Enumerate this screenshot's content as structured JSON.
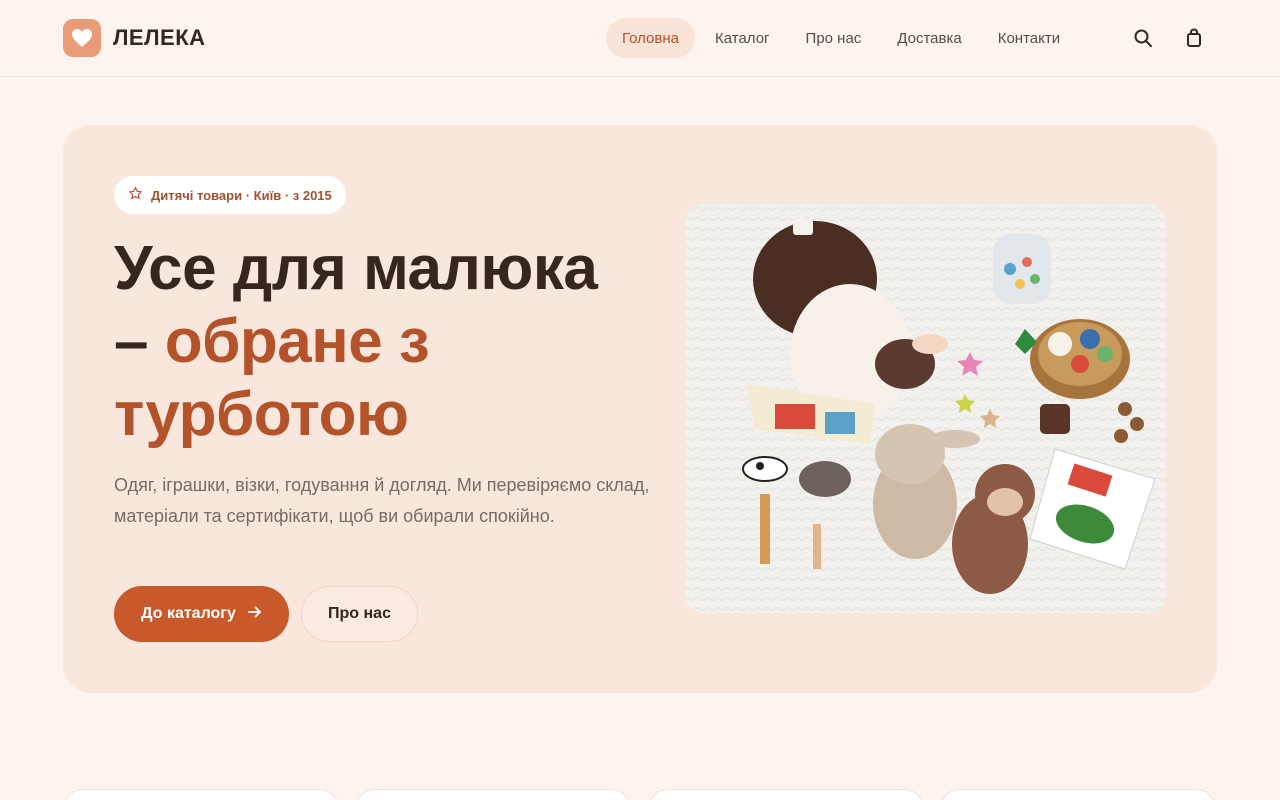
{
  "brand": {
    "name": "ЛЕЛЕКА",
    "color": "#e99b78"
  },
  "nav": {
    "items": [
      {
        "label": "Головна",
        "active": true
      },
      {
        "label": "Каталог",
        "active": false
      },
      {
        "label": "Про нас",
        "active": false
      },
      {
        "label": "Доставка",
        "active": false
      },
      {
        "label": "Контакти",
        "active": false
      }
    ],
    "icons": [
      "search-icon",
      "shopping-bag-icon"
    ]
  },
  "hero": {
    "badge": "Дитячі товари · Київ · з 2015",
    "title_main": "Усе для малюка",
    "title_dash": "–",
    "title_accent": "обране з турботою",
    "description": "Одяг, іграшки, візки, годування й догляд. Ми перевіряємо склад, матеріали та сертифікати, щоб ви обирали спокійно.",
    "primary_button": "До каталогу",
    "secondary_button": "Про нас",
    "image_alt": "photo-baby-with-toys"
  },
  "colors": {
    "accent": "#b4532a",
    "button": "#c9592b",
    "background": "#fdf4ef",
    "hero_bg": "#f9e6dc"
  }
}
